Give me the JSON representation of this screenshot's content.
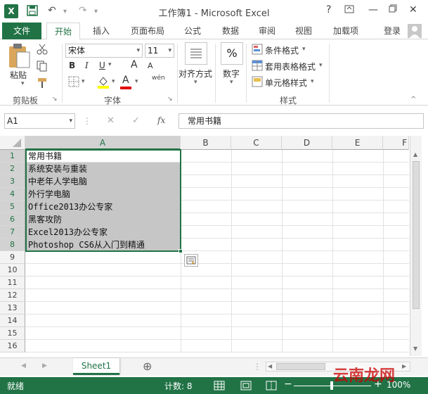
{
  "window": {
    "title": "工作簿1 - Microsoft Excel",
    "help": "?",
    "minimize": "—",
    "close": "✕"
  },
  "tabs": [
    {
      "label": "文件"
    },
    {
      "label": "开始"
    },
    {
      "label": "插入"
    },
    {
      "label": "页面布局"
    },
    {
      "label": "公式"
    },
    {
      "label": "数据"
    },
    {
      "label": "审阅"
    },
    {
      "label": "视图"
    },
    {
      "label": "加载项"
    }
  ],
  "account": {
    "login": "登录"
  },
  "ribbon": {
    "clipboard": {
      "paste": "粘贴",
      "group": "剪贴板"
    },
    "font": {
      "name": "宋体",
      "size": "11",
      "bold": "B",
      "italic": "I",
      "underline": "U",
      "grow": "A",
      "shrink": "A",
      "font_color": "A",
      "wen": "wén",
      "group": "字体"
    },
    "align": {
      "label": "对齐方式"
    },
    "number": {
      "label": "数字",
      "symbol": "%"
    },
    "styles": {
      "cond": "条件格式",
      "table": "套用表格格式",
      "cell": "单元格样式",
      "group": "样式"
    }
  },
  "formula": {
    "namebox": "A1",
    "fx": "fx",
    "cancel": "✕",
    "enter": "✓",
    "value": "常用书籍"
  },
  "columns": [
    "A",
    "B",
    "C",
    "D",
    "E",
    "F"
  ],
  "rows": [
    "1",
    "2",
    "3",
    "4",
    "5",
    "6",
    "7",
    "8",
    "9",
    "10",
    "11",
    "12",
    "13",
    "14",
    "15",
    "16"
  ],
  "cells": [
    "常用书籍",
    "系统安装与重装",
    "中老年人学电脑",
    "外行学电脑",
    "Office2013办公专家",
    "黑客攻防",
    "Excel2013办公专家",
    "Photoshop CS6从入门到精通"
  ],
  "sheet": {
    "name": "Sheet1",
    "add": "⊕"
  },
  "status": {
    "ready": "就绪",
    "count": "计数: 8",
    "zoom": "100%"
  },
  "watermark": "云南龙网",
  "colors": {
    "excel_green": "#217346",
    "selection": "#c6c6c6"
  }
}
